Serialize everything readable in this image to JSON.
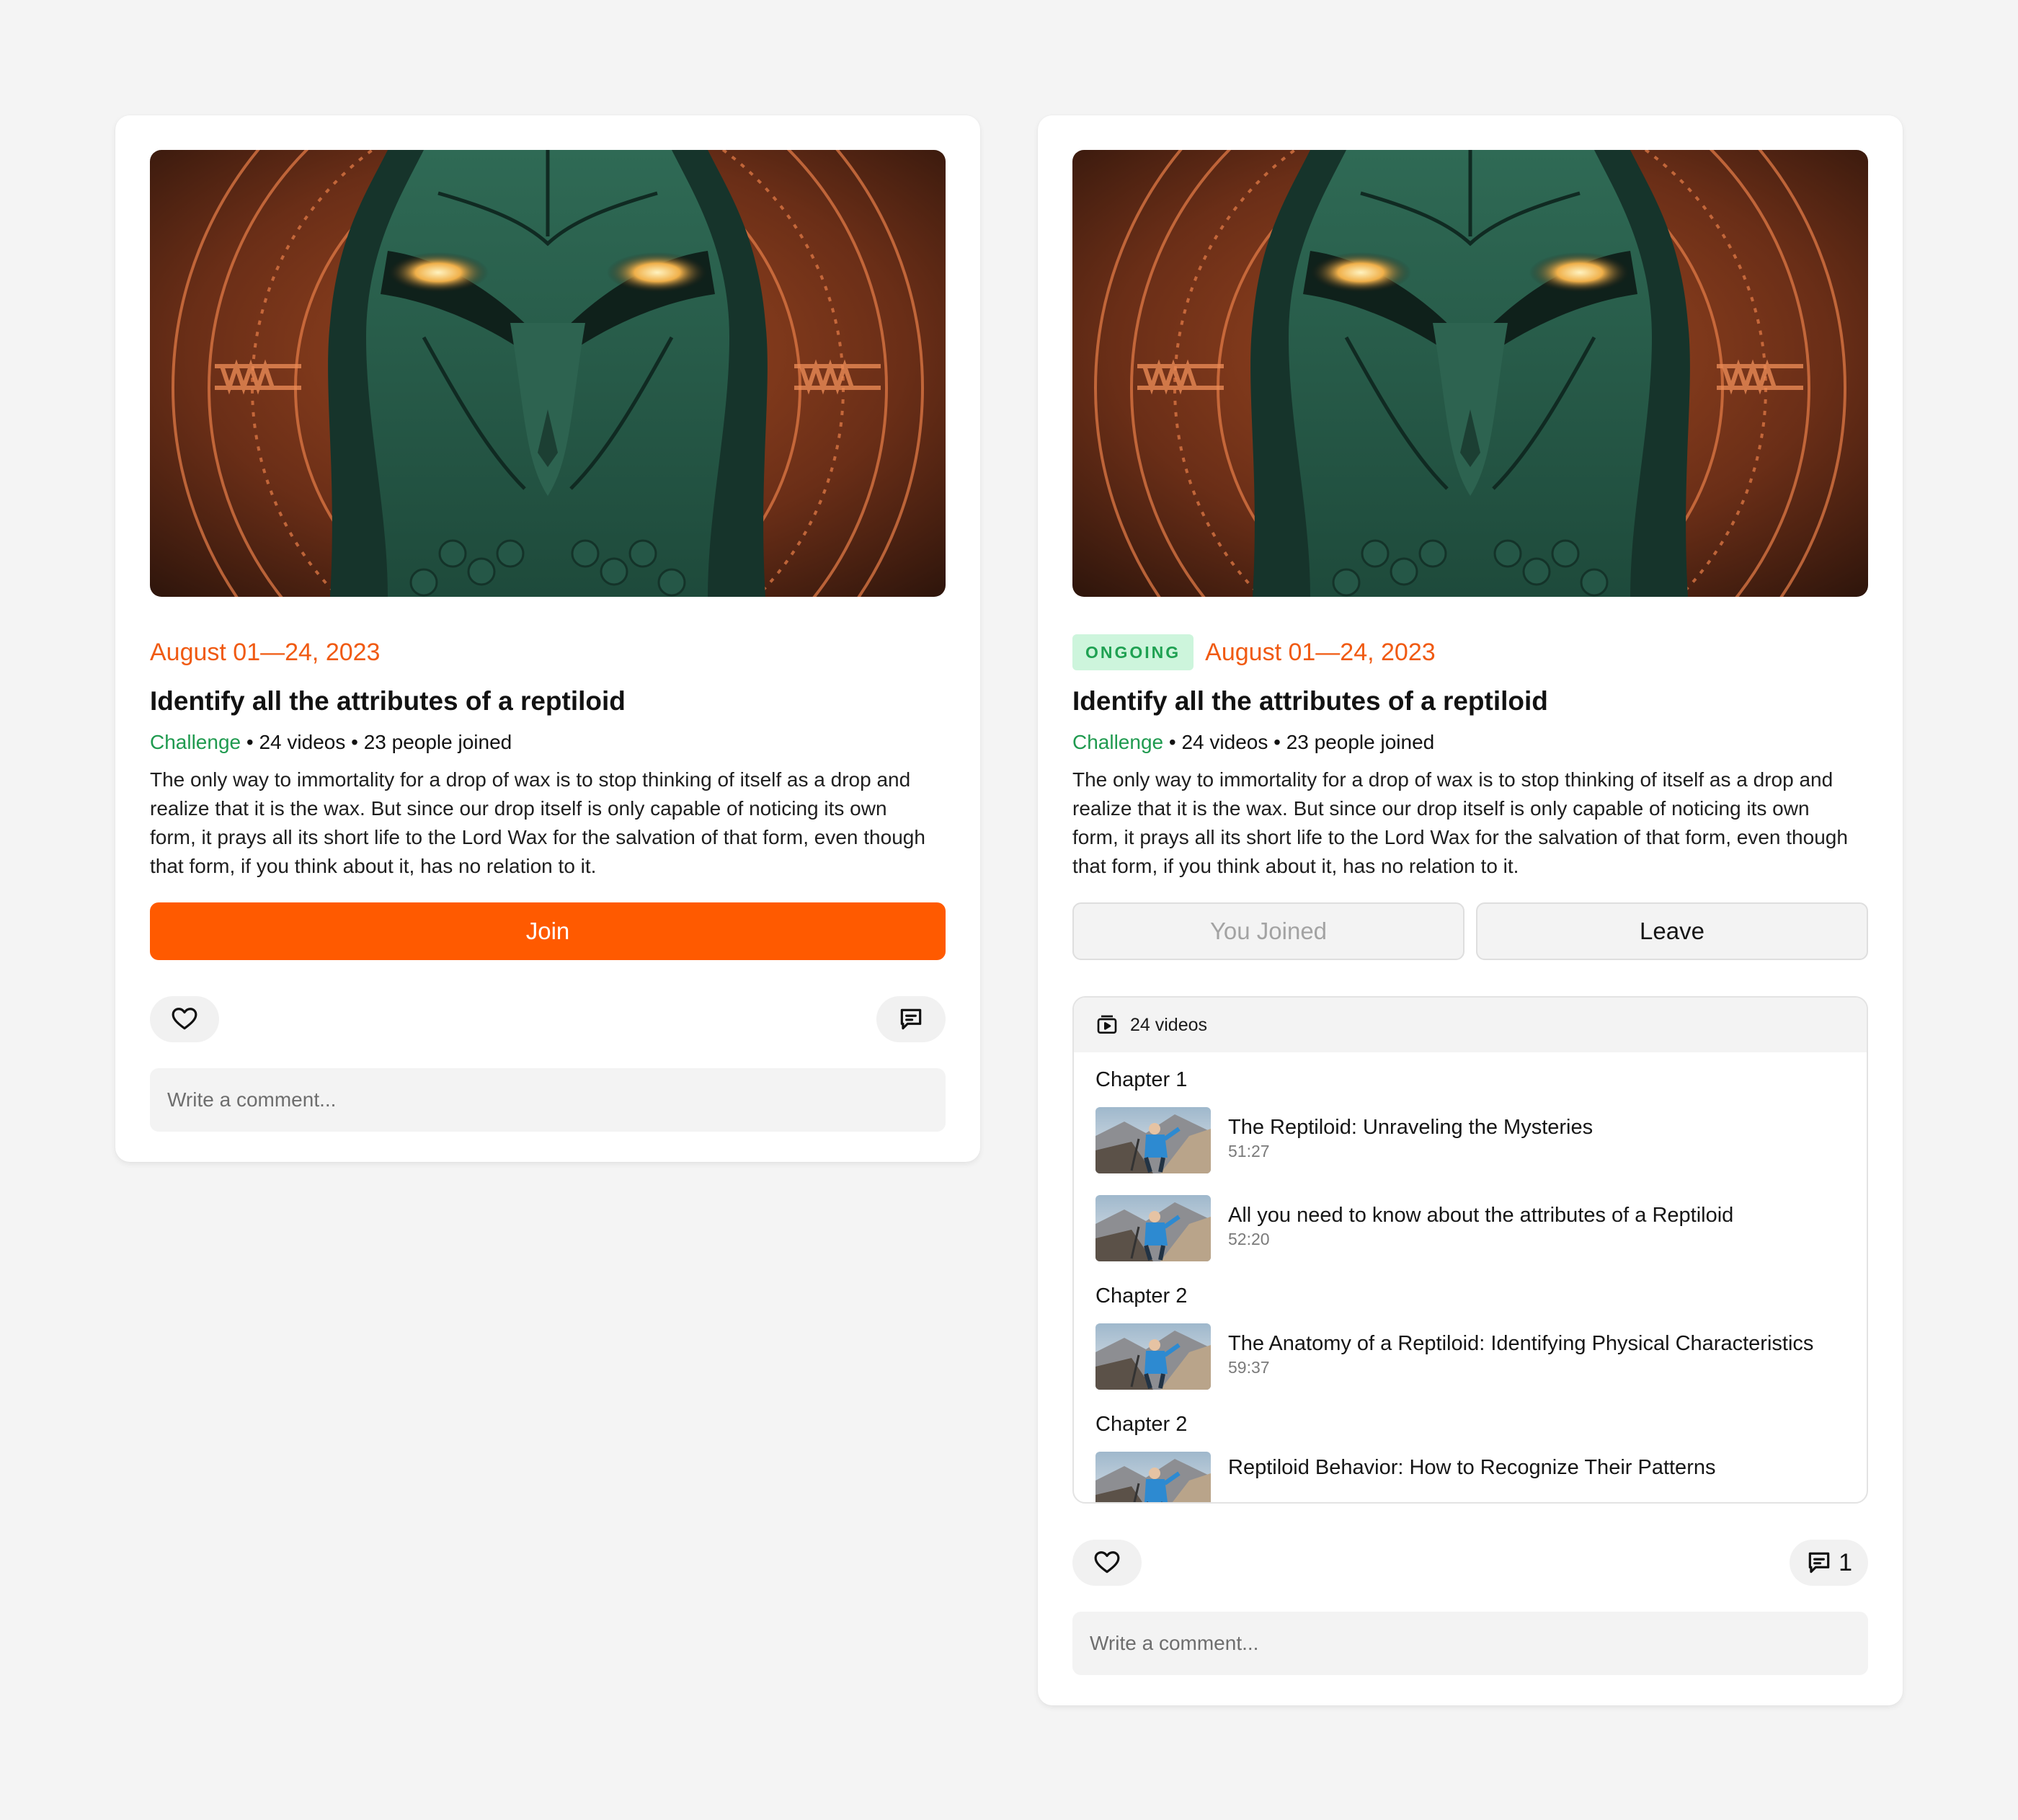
{
  "cards": [
    {
      "date": "August 01—24, 2023",
      "title": "Identify all the attributes of a reptiloid",
      "meta": {
        "kind": "Challenge",
        "rest": " • 24 videos • 23 people joined"
      },
      "description": "The only way to immortality for a drop of wax is to stop thinking of itself as a drop and realize that it is the wax. But since our drop itself is only capable of noticing its own form, it prays all its short life to the Lord Wax for the salvation of that form, even though that form, if you think about it, has no relation to it.",
      "join_label": "Join",
      "comment_placeholder": "Write a comment..."
    },
    {
      "status_badge": "ONGOING",
      "date": "August 01—24, 2023",
      "title": "Identify all the attributes of a reptiloid",
      "meta": {
        "kind": "Challenge",
        "rest": " • 24 videos • 23 people joined"
      },
      "description": "The only way to immortality for a drop of wax is to stop thinking of itself as a drop and realize that it is the wax. But since our drop itself is only capable of noticing its own form, it prays all its short life to the Lord Wax for the salvation of that form, even though that form, if you think about it, has no relation to it.",
      "joined_label": "You Joined",
      "leave_label": "Leave",
      "videos_header": "24 videos",
      "chapters": [
        {
          "name": "Chapter 1",
          "videos": [
            {
              "title": "The Reptiloid: Unraveling the Mysteries",
              "duration": "51:27"
            },
            {
              "title": "All you need to know about the attributes of a Reptiloid",
              "duration": "52:20"
            }
          ]
        },
        {
          "name": "Chapter 2",
          "videos": [
            {
              "title": "The Anatomy of a Reptiloid: Identifying Physical Characteristics",
              "duration": "59:37"
            }
          ]
        },
        {
          "name": "Chapter 2",
          "videos": [
            {
              "title": "Reptiloid Behavior: How to Recognize Their Patterns",
              "duration": ""
            }
          ]
        }
      ],
      "comment_count": "1",
      "comment_placeholder": "Write a comment..."
    }
  ],
  "icons": {
    "like": "heart-icon",
    "comment": "comment-icon",
    "videos": "video-playlist-icon"
  },
  "colors": {
    "accent": "#ff5a00",
    "date": "#f05a12",
    "challenge": "#1f9a4f",
    "badge_bg": "#cdf5dc"
  }
}
